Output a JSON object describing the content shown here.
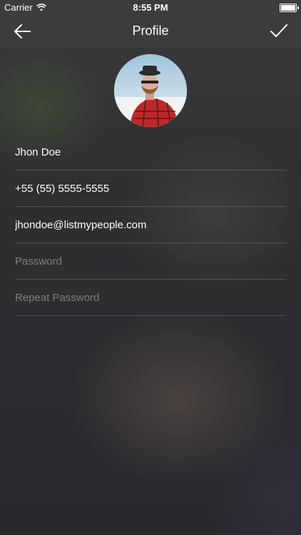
{
  "status_bar": {
    "carrier": "Carrier",
    "time": "8:55 PM",
    "wifi_icon": "wifi-icon",
    "battery_icon": "battery-icon"
  },
  "nav": {
    "title": "Profile",
    "back_icon": "arrow-left-icon",
    "confirm_icon": "checkmark-icon"
  },
  "profile": {
    "avatar": "profile-photo"
  },
  "form": {
    "name": {
      "value": "Jhon Doe",
      "placeholder": ""
    },
    "phone": {
      "value": "+55 (55) 5555-5555",
      "placeholder": ""
    },
    "email": {
      "value": "jhondoe@listmypeople.com",
      "placeholder": ""
    },
    "password": {
      "value": "",
      "placeholder": "Password"
    },
    "repeat_password": {
      "value": "",
      "placeholder": "Repeat Password"
    }
  },
  "colors": {
    "bar_background": "#3c3c3c",
    "text": "#ffffff",
    "placeholder": "#8a8a8e",
    "divider": "#5a5a5e"
  }
}
